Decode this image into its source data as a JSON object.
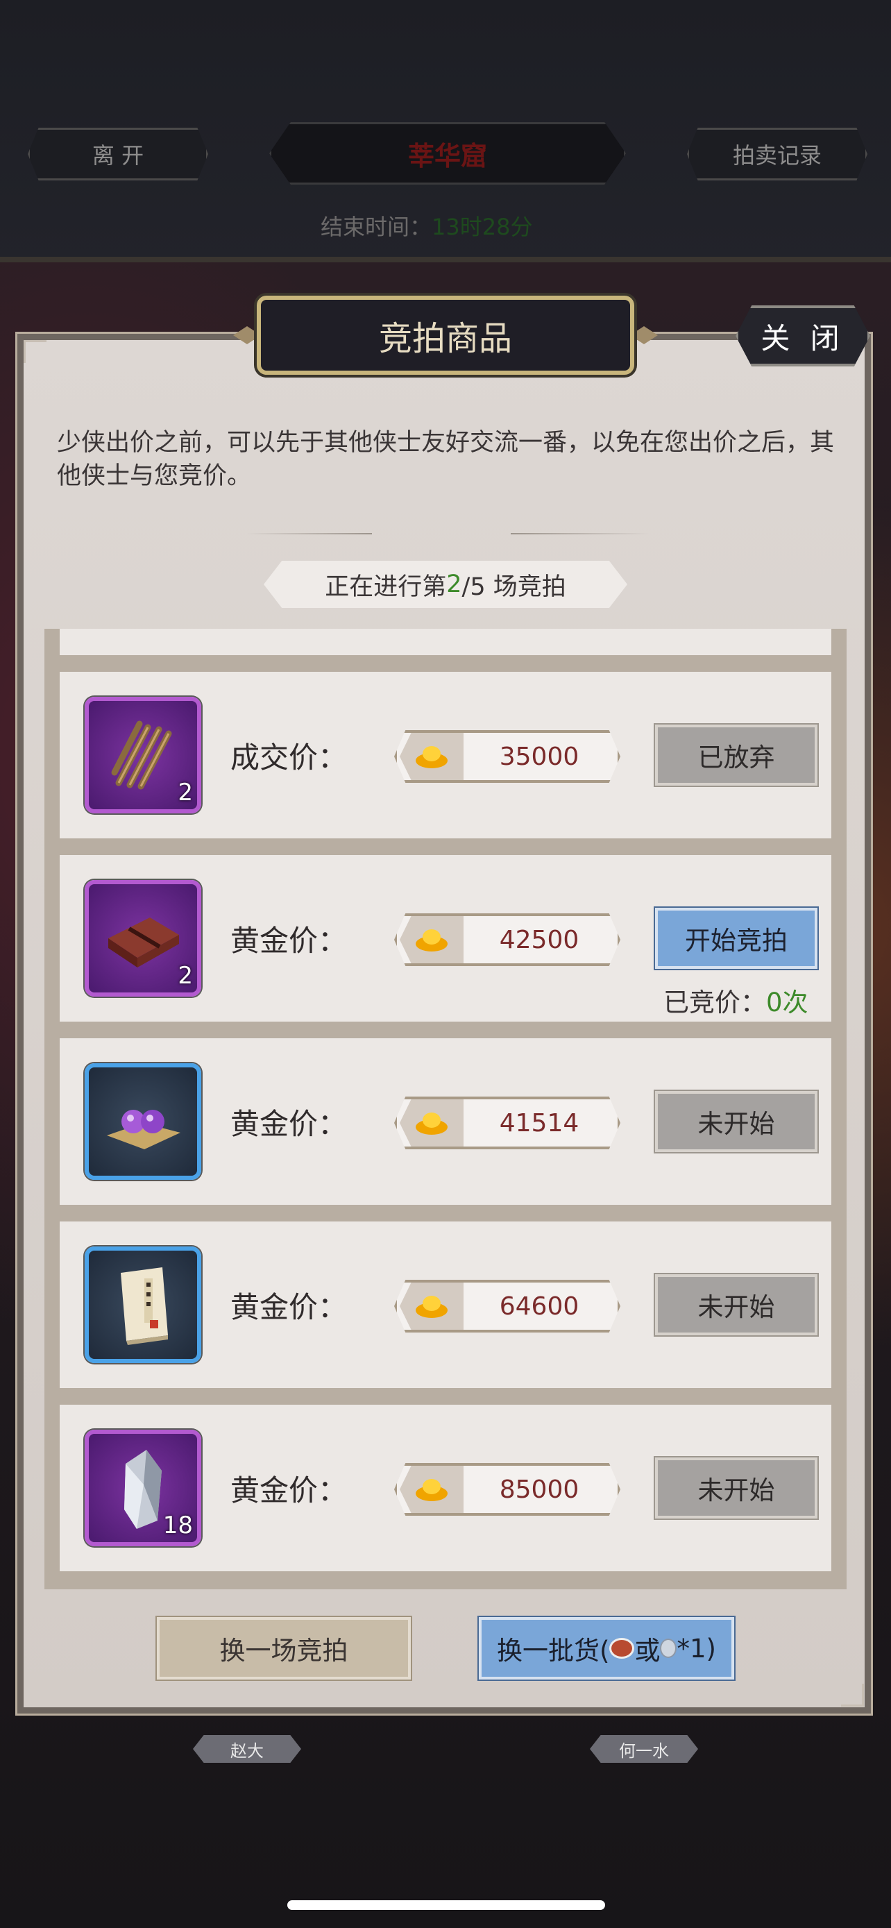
{
  "hud": {
    "leave_label": "离 开",
    "scene_title": "莘华窟",
    "record_label": "拍卖记录",
    "end_time_label": "结束时间：",
    "end_time_value": "13时28分"
  },
  "dialog": {
    "title": "竞拍商品",
    "close_label": "关 闭",
    "intro": "少侠出价之前，可以先于其他侠士友好交流一番，以免在您出价之后，其他侠士与您竞价。",
    "round": {
      "prefix": "正在进行第 ",
      "current": "2",
      "rest": "/5 场竞拍"
    }
  },
  "items": [
    {
      "icon": "rope-icon",
      "frame": "purple",
      "count": "2",
      "price_label": "成交价：",
      "price": "35000",
      "action": "已放弃",
      "action_style": "gray"
    },
    {
      "icon": "leather-bundle-icon",
      "frame": "purple",
      "count": "2",
      "price_label": "黄金价：",
      "price": "42500",
      "action": "开始竞拍",
      "action_style": "blue",
      "bid_label": "已竞价：",
      "bid_count": "0次"
    },
    {
      "icon": "orbs-icon",
      "frame": "blue",
      "count": "",
      "price_label": "黄金价：",
      "price": "41514",
      "action": "未开始",
      "action_style": "gray"
    },
    {
      "icon": "book-icon",
      "frame": "blue",
      "count": "",
      "price_label": "黄金价：",
      "price": "64600",
      "action": "未开始",
      "action_style": "gray"
    },
    {
      "icon": "crystal-icon",
      "frame": "purple",
      "count": "18",
      "price_label": "黄金价：",
      "price": "85000",
      "action": "未开始",
      "action_style": "gray"
    }
  ],
  "footer": {
    "swap_round_label": "换一场竞拍",
    "swap_goods_prefix": "换一批货(",
    "swap_goods_or": "或",
    "swap_goods_suffix": "*1)"
  },
  "npcs": [
    "赵大",
    "何一水"
  ],
  "colors": {
    "accent_green": "#3d8a2a",
    "price_red": "#7a2a2a",
    "button_blue": "#7aa6d8",
    "frame_gold": "#c9b67c"
  }
}
